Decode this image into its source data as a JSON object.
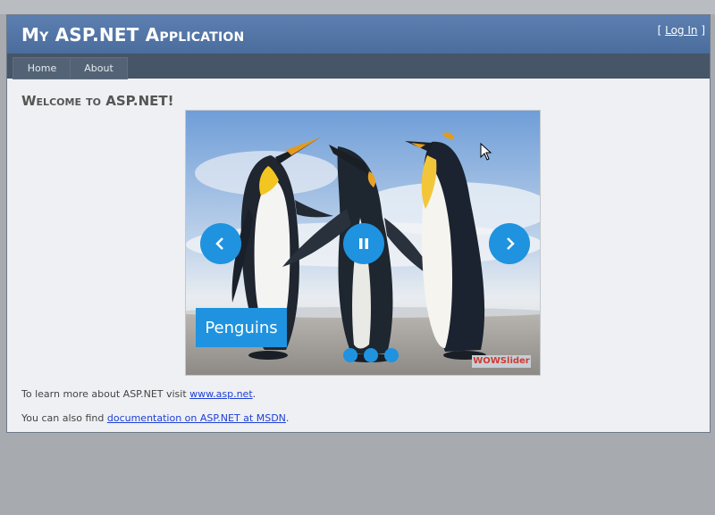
{
  "header": {
    "title": "My ASP.NET Application",
    "login_open": "[ ",
    "login_label": "Log In",
    "login_close": " ]"
  },
  "menu": {
    "items": [
      {
        "label": "Home"
      },
      {
        "label": "About"
      }
    ]
  },
  "main": {
    "welcome": "Welcome to ASP.NET!",
    "paragraph1": {
      "prefix": "To learn more about ASP.NET visit ",
      "link": "www.asp.net",
      "suffix": "."
    },
    "paragraph2": {
      "prefix": "You can also find ",
      "link": "documentation on ASP.NET at MSDN",
      "suffix": "."
    }
  },
  "slider": {
    "caption": "Penguins",
    "brand": "WOWSlider",
    "image": "penguins-photo",
    "buttons": {
      "prev": "chevron-left-icon",
      "pause": "pause-icon",
      "next": "chevron-right-icon"
    },
    "slide_count": 3
  },
  "colors": {
    "header": "#4f72a4",
    "menubar": "#465567",
    "slider_accent": "#1f93df",
    "link": "#1f40d6",
    "page_bg": "#eef0f3"
  }
}
